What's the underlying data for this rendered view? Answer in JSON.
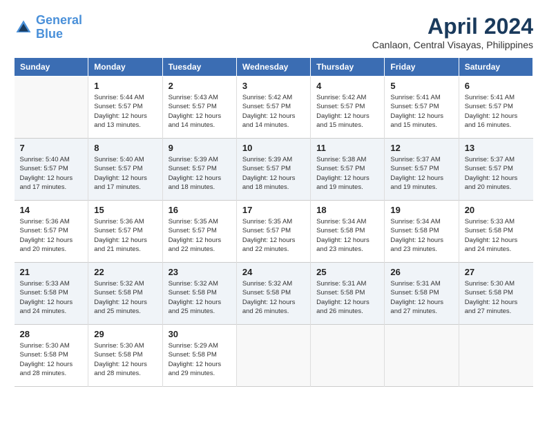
{
  "header": {
    "logo_general": "General",
    "logo_blue": "Blue",
    "month": "April 2024",
    "location": "Canlaon, Central Visayas, Philippines"
  },
  "columns": [
    "Sunday",
    "Monday",
    "Tuesday",
    "Wednesday",
    "Thursday",
    "Friday",
    "Saturday"
  ],
  "weeks": [
    [
      {
        "day": "",
        "sunrise": "",
        "sunset": "",
        "daylight": ""
      },
      {
        "day": "1",
        "sunrise": "Sunrise: 5:44 AM",
        "sunset": "Sunset: 5:57 PM",
        "daylight": "Daylight: 12 hours and 13 minutes."
      },
      {
        "day": "2",
        "sunrise": "Sunrise: 5:43 AM",
        "sunset": "Sunset: 5:57 PM",
        "daylight": "Daylight: 12 hours and 14 minutes."
      },
      {
        "day": "3",
        "sunrise": "Sunrise: 5:42 AM",
        "sunset": "Sunset: 5:57 PM",
        "daylight": "Daylight: 12 hours and 14 minutes."
      },
      {
        "day": "4",
        "sunrise": "Sunrise: 5:42 AM",
        "sunset": "Sunset: 5:57 PM",
        "daylight": "Daylight: 12 hours and 15 minutes."
      },
      {
        "day": "5",
        "sunrise": "Sunrise: 5:41 AM",
        "sunset": "Sunset: 5:57 PM",
        "daylight": "Daylight: 12 hours and 15 minutes."
      },
      {
        "day": "6",
        "sunrise": "Sunrise: 5:41 AM",
        "sunset": "Sunset: 5:57 PM",
        "daylight": "Daylight: 12 hours and 16 minutes."
      }
    ],
    [
      {
        "day": "7",
        "sunrise": "Sunrise: 5:40 AM",
        "sunset": "Sunset: 5:57 PM",
        "daylight": "Daylight: 12 hours and 17 minutes."
      },
      {
        "day": "8",
        "sunrise": "Sunrise: 5:40 AM",
        "sunset": "Sunset: 5:57 PM",
        "daylight": "Daylight: 12 hours and 17 minutes."
      },
      {
        "day": "9",
        "sunrise": "Sunrise: 5:39 AM",
        "sunset": "Sunset: 5:57 PM",
        "daylight": "Daylight: 12 hours and 18 minutes."
      },
      {
        "day": "10",
        "sunrise": "Sunrise: 5:39 AM",
        "sunset": "Sunset: 5:57 PM",
        "daylight": "Daylight: 12 hours and 18 minutes."
      },
      {
        "day": "11",
        "sunrise": "Sunrise: 5:38 AM",
        "sunset": "Sunset: 5:57 PM",
        "daylight": "Daylight: 12 hours and 19 minutes."
      },
      {
        "day": "12",
        "sunrise": "Sunrise: 5:37 AM",
        "sunset": "Sunset: 5:57 PM",
        "daylight": "Daylight: 12 hours and 19 minutes."
      },
      {
        "day": "13",
        "sunrise": "Sunrise: 5:37 AM",
        "sunset": "Sunset: 5:57 PM",
        "daylight": "Daylight: 12 hours and 20 minutes."
      }
    ],
    [
      {
        "day": "14",
        "sunrise": "Sunrise: 5:36 AM",
        "sunset": "Sunset: 5:57 PM",
        "daylight": "Daylight: 12 hours and 20 minutes."
      },
      {
        "day": "15",
        "sunrise": "Sunrise: 5:36 AM",
        "sunset": "Sunset: 5:57 PM",
        "daylight": "Daylight: 12 hours and 21 minutes."
      },
      {
        "day": "16",
        "sunrise": "Sunrise: 5:35 AM",
        "sunset": "Sunset: 5:57 PM",
        "daylight": "Daylight: 12 hours and 22 minutes."
      },
      {
        "day": "17",
        "sunrise": "Sunrise: 5:35 AM",
        "sunset": "Sunset: 5:57 PM",
        "daylight": "Daylight: 12 hours and 22 minutes."
      },
      {
        "day": "18",
        "sunrise": "Sunrise: 5:34 AM",
        "sunset": "Sunset: 5:58 PM",
        "daylight": "Daylight: 12 hours and 23 minutes."
      },
      {
        "day": "19",
        "sunrise": "Sunrise: 5:34 AM",
        "sunset": "Sunset: 5:58 PM",
        "daylight": "Daylight: 12 hours and 23 minutes."
      },
      {
        "day": "20",
        "sunrise": "Sunrise: 5:33 AM",
        "sunset": "Sunset: 5:58 PM",
        "daylight": "Daylight: 12 hours and 24 minutes."
      }
    ],
    [
      {
        "day": "21",
        "sunrise": "Sunrise: 5:33 AM",
        "sunset": "Sunset: 5:58 PM",
        "daylight": "Daylight: 12 hours and 24 minutes."
      },
      {
        "day": "22",
        "sunrise": "Sunrise: 5:32 AM",
        "sunset": "Sunset: 5:58 PM",
        "daylight": "Daylight: 12 hours and 25 minutes."
      },
      {
        "day": "23",
        "sunrise": "Sunrise: 5:32 AM",
        "sunset": "Sunset: 5:58 PM",
        "daylight": "Daylight: 12 hours and 25 minutes."
      },
      {
        "day": "24",
        "sunrise": "Sunrise: 5:32 AM",
        "sunset": "Sunset: 5:58 PM",
        "daylight": "Daylight: 12 hours and 26 minutes."
      },
      {
        "day": "25",
        "sunrise": "Sunrise: 5:31 AM",
        "sunset": "Sunset: 5:58 PM",
        "daylight": "Daylight: 12 hours and 26 minutes."
      },
      {
        "day": "26",
        "sunrise": "Sunrise: 5:31 AM",
        "sunset": "Sunset: 5:58 PM",
        "daylight": "Daylight: 12 hours and 27 minutes."
      },
      {
        "day": "27",
        "sunrise": "Sunrise: 5:30 AM",
        "sunset": "Sunset: 5:58 PM",
        "daylight": "Daylight: 12 hours and 27 minutes."
      }
    ],
    [
      {
        "day": "28",
        "sunrise": "Sunrise: 5:30 AM",
        "sunset": "Sunset: 5:58 PM",
        "daylight": "Daylight: 12 hours and 28 minutes."
      },
      {
        "day": "29",
        "sunrise": "Sunrise: 5:30 AM",
        "sunset": "Sunset: 5:58 PM",
        "daylight": "Daylight: 12 hours and 28 minutes."
      },
      {
        "day": "30",
        "sunrise": "Sunrise: 5:29 AM",
        "sunset": "Sunset: 5:58 PM",
        "daylight": "Daylight: 12 hours and 29 minutes."
      },
      {
        "day": "",
        "sunrise": "",
        "sunset": "",
        "daylight": ""
      },
      {
        "day": "",
        "sunrise": "",
        "sunset": "",
        "daylight": ""
      },
      {
        "day": "",
        "sunrise": "",
        "sunset": "",
        "daylight": ""
      },
      {
        "day": "",
        "sunrise": "",
        "sunset": "",
        "daylight": ""
      }
    ]
  ]
}
